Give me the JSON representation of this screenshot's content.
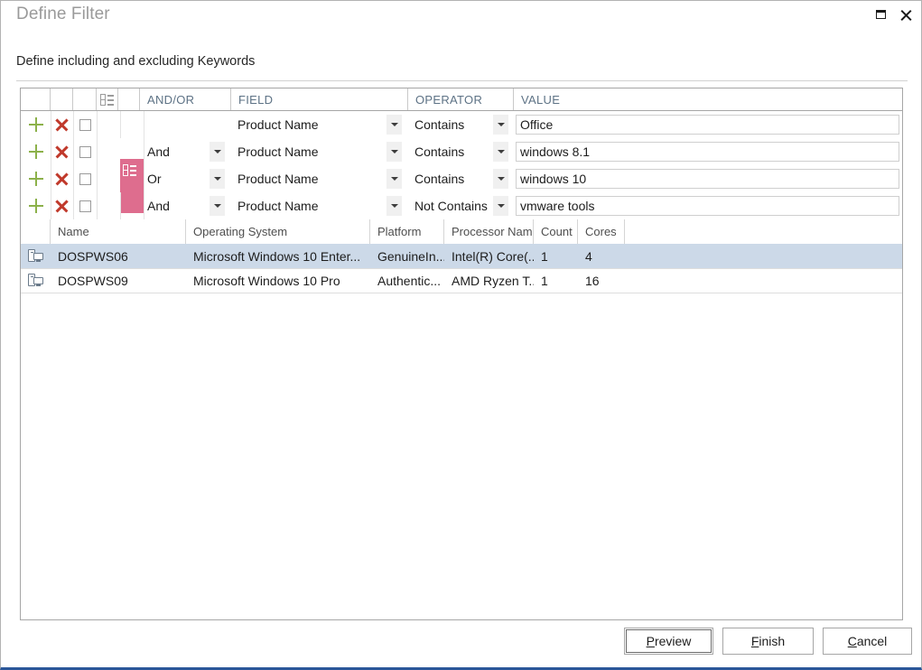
{
  "window": {
    "title": "Define Filter",
    "maximize_icon": "maximize-icon",
    "close_icon": "close-icon"
  },
  "subtitle": "Define including and excluding Keywords",
  "filter_grid": {
    "headers": {
      "add": "",
      "remove": "",
      "check": "",
      "group_icon": "group-list-icon",
      "spacer": "",
      "and_or": "AND/OR",
      "field": "FIELD",
      "operator": "OPERATOR",
      "value": "VALUE"
    },
    "rows": [
      {
        "add_icon": "add-icon",
        "remove_icon": "remove-icon",
        "checked": false,
        "and_or": "",
        "has_and_or_dropdown": false,
        "field": "Product Name",
        "operator": "Contains",
        "value": "Office"
      },
      {
        "add_icon": "add-icon",
        "remove_icon": "remove-icon",
        "checked": false,
        "and_or": "And",
        "has_and_or_dropdown": true,
        "field": "Product Name",
        "operator": "Contains",
        "value": "windows 8.1"
      },
      {
        "add_icon": "add-icon",
        "remove_icon": "remove-icon",
        "checked": false,
        "and_or": "Or",
        "has_and_or_dropdown": true,
        "field": "Product Name",
        "operator": "Contains",
        "value": "windows 10"
      },
      {
        "add_icon": "add-icon",
        "remove_icon": "remove-icon",
        "checked": false,
        "and_or": "And",
        "has_and_or_dropdown": true,
        "field": "Product Name",
        "operator": "Not Contains",
        "value": "vmware tools"
      }
    ],
    "group_marker": {
      "color": "#de6d8e",
      "spans_rows": [
        2,
        3
      ],
      "icon": "group-list-icon"
    }
  },
  "results_grid": {
    "columns": [
      "",
      "Name",
      "Operating System",
      "Platform",
      "Processor Name",
      "Count",
      "Cores",
      ""
    ],
    "rows": [
      {
        "icon": "computer-icon",
        "name": "DOSPWS06",
        "operating_system": "Microsoft Windows 10 Enter...",
        "platform": "GenuineIn...",
        "processor_name": "Intel(R) Core(...",
        "count": "1",
        "cores": "4",
        "selected": true
      },
      {
        "icon": "computer-icon",
        "name": "DOSPWS09",
        "operating_system": "Microsoft Windows 10 Pro",
        "platform": "Authentic...",
        "processor_name": "AMD Ryzen T...",
        "count": "1",
        "cores": "16",
        "selected": false
      }
    ]
  },
  "footer": {
    "preview": {
      "mnemonic": "P",
      "rest": "review",
      "focused": true
    },
    "finish": {
      "mnemonic": "F",
      "rest": "inish",
      "focused": false
    },
    "cancel": {
      "mnemonic": "C",
      "rest": "ancel",
      "focused": false
    }
  },
  "colors": {
    "group_pink": "#de6d8e",
    "add_green": "#8cb14a",
    "remove_red": "#c0392b",
    "selection_blue": "#ccd9e8",
    "header_text": "#5d7285",
    "window_accent": "#2a5699"
  }
}
